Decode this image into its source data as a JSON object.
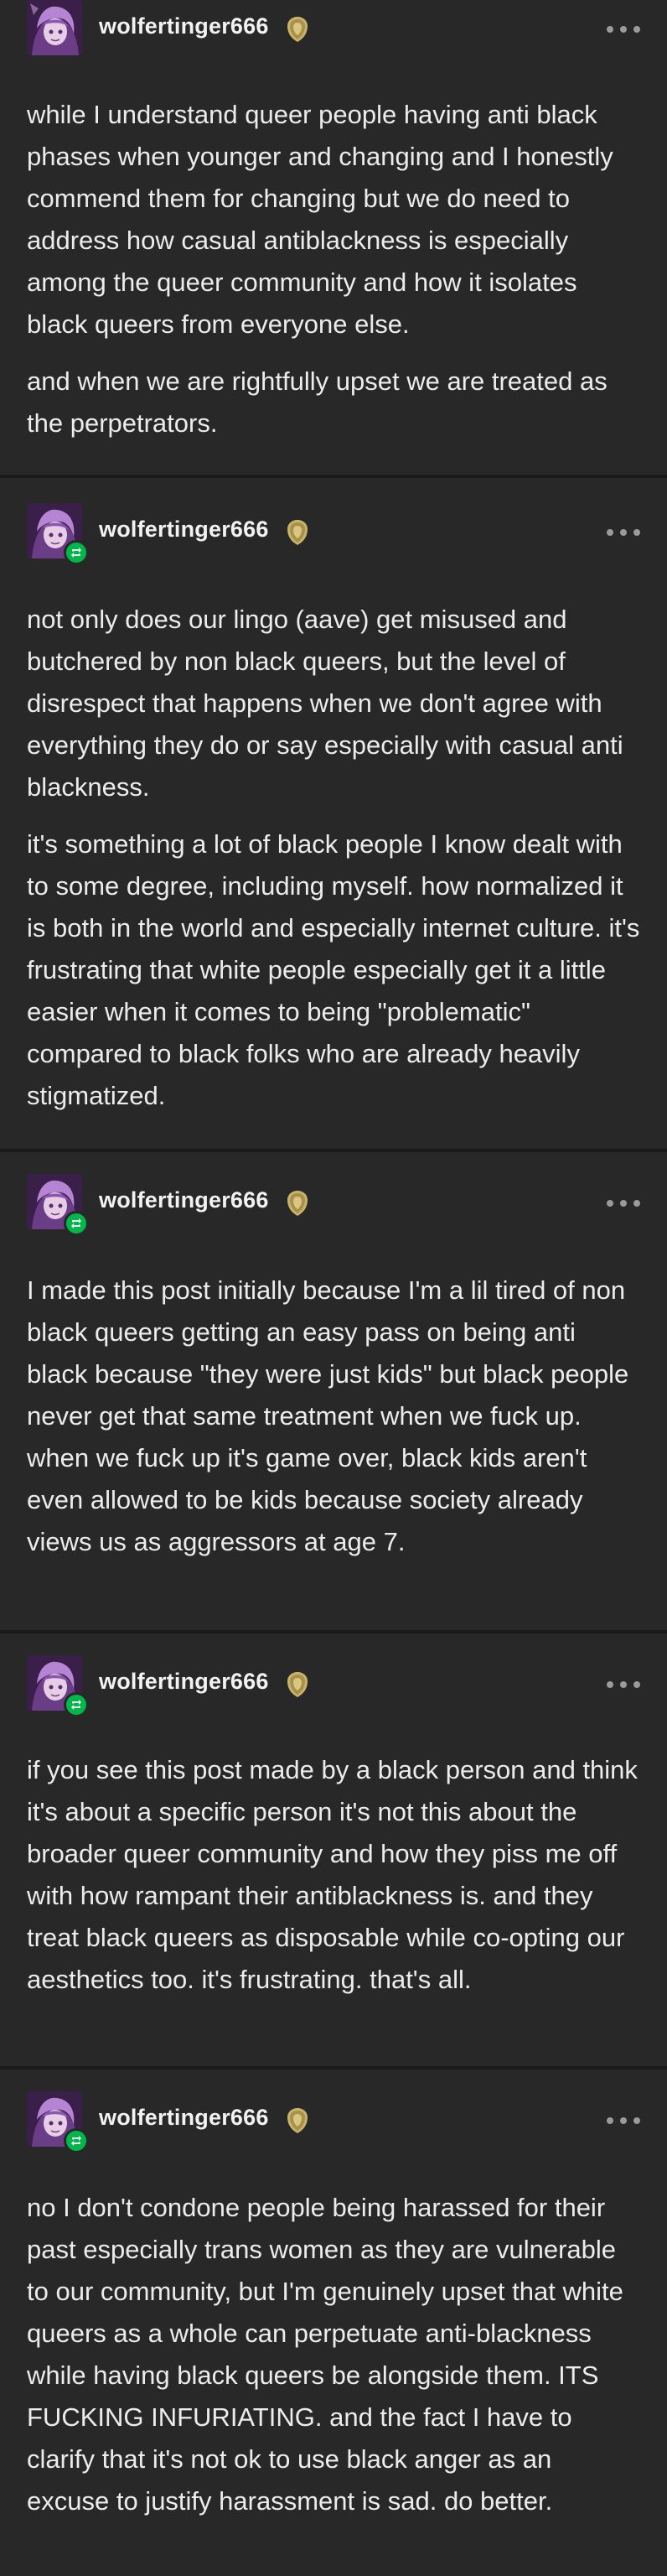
{
  "posts": [
    {
      "username": "wolfertinger666",
      "reblogged": false,
      "paragraphs": [
        "while I understand queer people having anti black phases when younger and changing and I honestly commend them for changing but we do need to address how casual antiblackness is especially among the queer community and how it isolates black queers from everyone else.",
        "and when we are rightfully upset we are treated as the perpetrators."
      ]
    },
    {
      "username": "wolfertinger666",
      "reblogged": true,
      "paragraphs": [
        "not only does our lingo (aave) get misused and butchered by non black queers, but the level of disrespect that happens when we don't agree with everything they do or say especially with casual anti blackness.",
        "it's something a lot of black people I know dealt with to some degree, including myself. how normalized it is both in the world and especially internet culture. it's frustrating that white people especially get it a little easier when it comes to being \"problematic\" compared to black folks who are already heavily stigmatized."
      ]
    },
    {
      "username": "wolfertinger666",
      "reblogged": true,
      "paragraphs": [
        "I made this post initially because I'm a lil tired of non black queers getting an easy pass on being anti black because \"they were just kids\" but black people never get that same treatment when we fuck up. when we fuck up it's game over, black kids aren't even allowed to be kids because society already views us as aggressors at age 7."
      ]
    },
    {
      "username": "wolfertinger666",
      "reblogged": true,
      "paragraphs": [
        "if you see this post made by a black person and think it's about a specific person it's not this about the broader queer community and how they piss me off with how rampant their antiblackness is. and they treat black queers as disposable while co-opting our aesthetics too. it's frustrating. that's all."
      ]
    },
    {
      "username": "wolfertinger666",
      "reblogged": true,
      "paragraphs": [
        "no I don't condone people being harassed for their past especially trans women as they are vulnerable to our community, but I'm genuinely upset that white queers as a whole can perpetuate anti-blackness while having black  queers be alongside them. ITS FUCKING INFURIATING. and the fact I have to clarify that it's not ok to use black anger as an excuse to justify harassment is sad. do better."
      ]
    }
  ],
  "icons": {
    "avatar": "avatar-icon",
    "badge": "gold-badge-icon",
    "menu": "more-options-icon",
    "reblog": "reblog-icon"
  },
  "colors": {
    "background": "#282828",
    "divider": "#1a1a1a",
    "text": "#ececec",
    "reblog_green": "#00b84a",
    "badge_gold": "#c9b36a"
  }
}
